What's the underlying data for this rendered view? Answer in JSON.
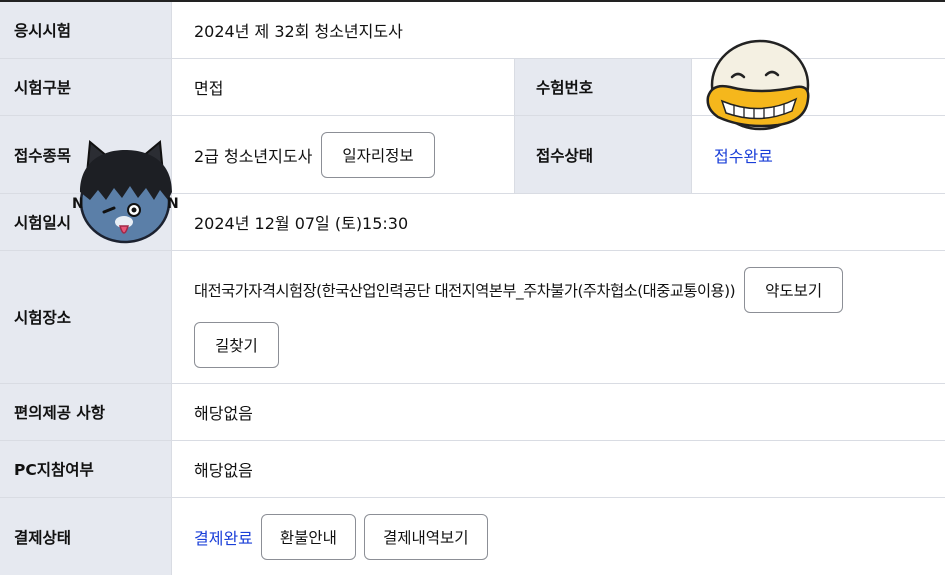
{
  "rows": {
    "exam": {
      "label": "응시시험",
      "value": "2024년 제 32회 청소년지도사"
    },
    "type": {
      "label": "시험구분",
      "value": "면접",
      "label2": "수험번호",
      "value2": ""
    },
    "category": {
      "label": "접수종목",
      "value": "2급 청소년지도사",
      "button": "일자리정보",
      "label2": "접수상태",
      "value2": "접수완료"
    },
    "datetime": {
      "label": "시험일시",
      "value": "2024년 12월 07일 (토)15:30"
    },
    "venue": {
      "label": "시험장소",
      "value": "대전국가자격시험장(한국산업인력공단 대전지역본부_주차불가(주차협소(대중교통이용))",
      "map_button": "약도보기",
      "route_button": "길찾기"
    },
    "convenience": {
      "label": "편의제공 사항",
      "value": "해당없음"
    },
    "pc": {
      "label": "PC지참여부",
      "value": "해당없음"
    },
    "payment": {
      "label": "결제상태",
      "value": "결제완료",
      "refund_button": "환불안내",
      "history_button": "결제내역보기"
    }
  },
  "colors": {
    "header_bg": "#e6e9f0",
    "status_blue": "#1a3fd8",
    "border": "#d9dce3"
  },
  "stickers": {
    "left": "cat-sticker-icon",
    "right": "duck-sticker-icon"
  }
}
